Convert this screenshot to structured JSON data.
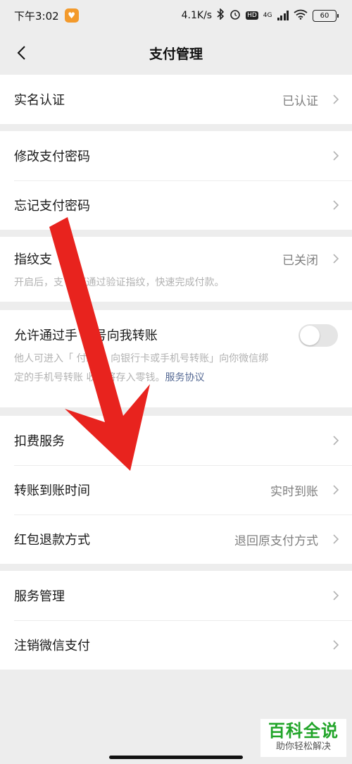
{
  "status_bar": {
    "time": "下午3:02",
    "network_speed": "4.1K/s",
    "hd": "HD",
    "net_type": "4G",
    "battery": "60"
  },
  "nav": {
    "title": "支付管理"
  },
  "groups": {
    "verify": {
      "label": "实名认证",
      "value": "已认证"
    },
    "password_change": {
      "label": "修改支付密码"
    },
    "password_forgot": {
      "label": "忘记支付密码"
    },
    "fingerprint": {
      "label": "指纹支",
      "value": "已关闭",
      "desc": "开启后，支  时可通过验证指纹，快速完成付款。"
    },
    "phone_transfer": {
      "label": "允许通过手 机号向我转账",
      "toggle_on": false,
      "desc_line1": "他人可进入「  付款 > 向银行卡或手机号转账」向你微信绑",
      "desc_line2": "定的手机号转账  收款将存入零钱。",
      "link": "服务协议"
    },
    "deduction": {
      "label": "扣费服务"
    },
    "arrival_time": {
      "label": "转账到账时间",
      "value": "实时到账"
    },
    "red_packet_refund": {
      "label": "红包退款方式",
      "value": "退回原支付方式"
    },
    "service_manage": {
      "label": "服务管理"
    },
    "cancel_pay": {
      "label": "注销微信支付"
    }
  },
  "watermark": {
    "main": "百科全说",
    "sub": "助你轻松解决"
  },
  "colors": {
    "background": "#ededed",
    "link": "#576b95",
    "annotation_arrow": "#e8231e",
    "watermark_green": "#22a52a"
  }
}
